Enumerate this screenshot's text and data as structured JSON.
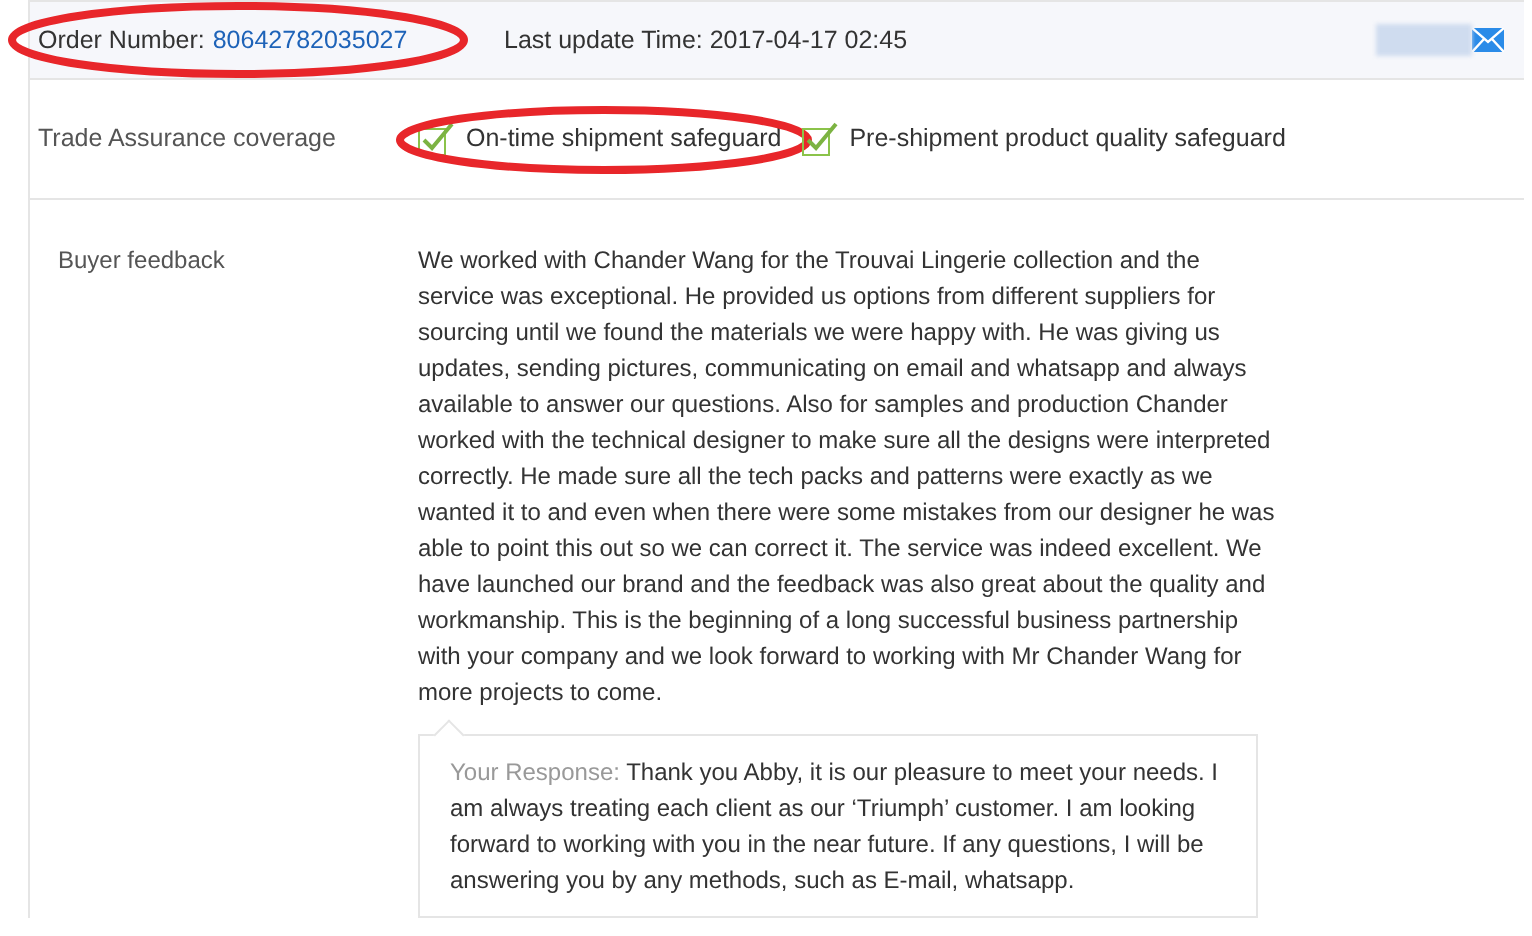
{
  "order": {
    "label": "Order Number:",
    "number": "80642782035027",
    "circled": true,
    "update_label": "Last update Time:",
    "update_time": "2017-04-17 02:45"
  },
  "coverage": {
    "label": "Trade Assurance coverage",
    "items": [
      {
        "text": "On-time shipment safeguard",
        "checked": true,
        "circled": true
      },
      {
        "text": "Pre-shipment product quality safeguard",
        "checked": true,
        "circled": false
      }
    ]
  },
  "feedback": {
    "label": "Buyer feedback",
    "text": "We worked with Chander Wang for the Trouvai Lingerie collection and the service was exceptional. He provided us options from different suppliers for sourcing until we found the materials we were happy with. He was giving us updates, sending pictures, communicating on email and whatsapp and always available to answer our questions. Also for samples and production Chander worked with the technical designer to make sure all the designs were interpreted correctly. He made sure all the tech packs and patterns were exactly as we wanted it to and even when there were some mistakes from our designer he was able to point this out so we can correct it. The service was indeed excellent. We have launched our brand and the feedback was also great about the quality and workmanship. This is the beginning of a long successful business partnership with your company and we look forward to working with Mr Chander Wang for more projects to come.",
    "response_label": "Your Response:",
    "response": "Thank you Abby, it is our pleasure to meet your needs. I am always treating each client as our ‘Triumph’ customer. I am looking forward to working with you in the near future. If any questions, I will be answering you by any methods, such as E-mail, whatsapp."
  }
}
